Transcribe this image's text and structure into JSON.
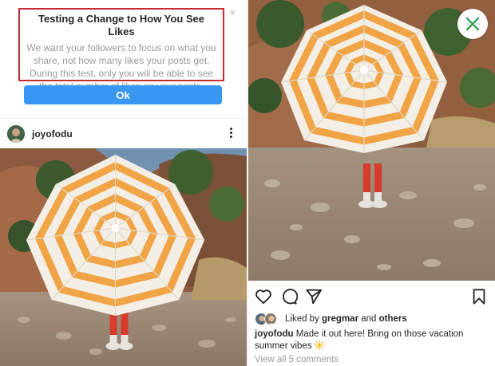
{
  "notice": {
    "title": "Testing a Change to How You See Likes",
    "body_lines": [
      "We want your followers to focus on what you",
      "share, not how many likes your posts get.",
      "During this test, only you will be able to see",
      "the total number of likes on your posts."
    ],
    "close_glyph": "×",
    "ok_label": "Ok",
    "highlight_color": "#c42b32",
    "button_color": "#3897f0"
  },
  "left_post": {
    "username": "joyofodu"
  },
  "right_post": {
    "liked_prefix": "Liked by ",
    "liked_user": "gregmar",
    "liked_middle": " and ",
    "liked_others": "others",
    "caption_user": "joyofodu",
    "caption_text": " Made it out here! Bring on those vacation summer vibes ",
    "view_comments": "View all 5 comments"
  },
  "icons": {
    "more": "more-vertical-icon",
    "close_badge": "close-x-icon",
    "like": "heart-icon",
    "comment": "comment-bubble-icon",
    "share": "paper-plane-icon",
    "save": "bookmark-icon",
    "emoji": "sun-emoji-icon"
  }
}
